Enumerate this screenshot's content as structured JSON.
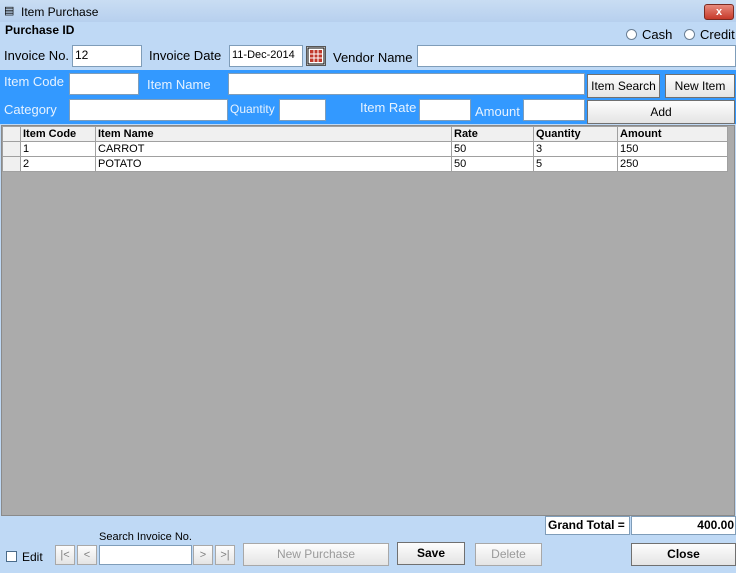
{
  "window": {
    "title": "Item Purchase",
    "close_glyph": "x"
  },
  "header": {
    "purchase_id_label": "Purchase ID"
  },
  "payment": {
    "cash_label": "Cash",
    "credit_label": "Credit"
  },
  "invoice": {
    "invoice_no_label": "Invoice No.",
    "invoice_no_value": "12",
    "invoice_date_label": "Invoice Date",
    "invoice_date_value": "11-Dec-2014",
    "vendor_label": "Vendor Name",
    "vendor_value": ""
  },
  "item_form": {
    "item_code_label": "Item Code",
    "item_name_label": "Item Name",
    "category_label": "Category",
    "quantity_label": "Quantity",
    "item_rate_label": "Item Rate",
    "amount_label": "Amount",
    "item_search_label": "Item Search",
    "new_item_label": "New Item",
    "add_label": "Add"
  },
  "grid": {
    "columns": [
      "Item Code",
      "Item Name",
      "Rate",
      "Quantity",
      "Amount"
    ],
    "rows": [
      [
        "1",
        "CARROT",
        "50",
        "3",
        "150"
      ],
      [
        "2",
        "POTATO",
        "50",
        "5",
        "250"
      ]
    ]
  },
  "totals": {
    "grand_total_label": "Grand Total =",
    "grand_total_value": "400.00"
  },
  "footer": {
    "edit_label": "Edit",
    "search_invoice_label": "Search Invoice No.",
    "nav_first": "|<",
    "nav_prev": "<",
    "nav_next": ">",
    "nav_last": ">|",
    "new_purchase_label": "New Purchase",
    "save_label": "Save",
    "delete_label": "Delete",
    "close_label": "Close"
  }
}
